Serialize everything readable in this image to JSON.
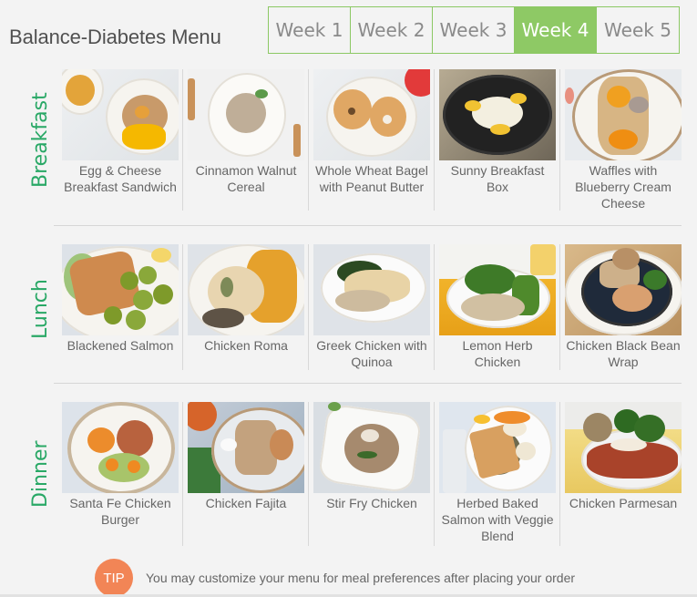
{
  "header": {
    "title": "Balance-Diabetes Menu"
  },
  "week_tabs": [
    {
      "label": "Week 1",
      "active": false
    },
    {
      "label": "Week 2",
      "active": false
    },
    {
      "label": "Week 3",
      "active": false
    },
    {
      "label": "Week 4",
      "active": true
    },
    {
      "label": "Week 5",
      "active": false
    }
  ],
  "colors": {
    "accent_green": "#8ec965",
    "section_label_green": "#29a866",
    "tip_orange": "#f28556"
  },
  "sections": [
    {
      "label": "Breakfast",
      "meals": [
        {
          "name": "Egg & Cheese Breakfast Sandwich",
          "lines": [
            "Egg & Cheese",
            "Breakfast Sandwich"
          ]
        },
        {
          "name": "Cinnamon Walnut Cereal",
          "lines": [
            "Cinnamon Walnut",
            "Cereal"
          ]
        },
        {
          "name": "Whole Wheat Bagel with Peanut Butter",
          "lines": [
            "Whole Wheat Bagel",
            "with Peanut Butter"
          ]
        },
        {
          "name": "Sunny Breakfast Box",
          "lines": [
            "Sunny Breakfast",
            "Box"
          ]
        },
        {
          "name": "Waffles with Blueberry Cream Cheese",
          "lines": [
            "Waffles with",
            "Blueberry Cream",
            "Cheese"
          ]
        }
      ]
    },
    {
      "label": "Lunch",
      "meals": [
        {
          "name": "Blackened Salmon",
          "lines": [
            "Blackened Salmon"
          ]
        },
        {
          "name": "Chicken Roma",
          "lines": [
            "Chicken Roma"
          ]
        },
        {
          "name": "Greek Chicken with Quinoa",
          "lines": [
            "Greek Chicken with",
            "Quinoa"
          ]
        },
        {
          "name": "Lemon Herb Chicken",
          "lines": [
            "Lemon Herb",
            "Chicken"
          ]
        },
        {
          "name": "Chicken Black Bean Wrap",
          "lines": [
            "Chicken Black Bean",
            "Wrap"
          ]
        }
      ]
    },
    {
      "label": "Dinner",
      "meals": [
        {
          "name": "Santa Fe Chicken Burger",
          "lines": [
            "Santa Fe Chicken",
            "Burger"
          ]
        },
        {
          "name": "Chicken Fajita",
          "lines": [
            "Chicken Fajita"
          ]
        },
        {
          "name": "Stir Fry Chicken",
          "lines": [
            "Stir Fry Chicken"
          ]
        },
        {
          "name": "Herbed Baked Salmon with Veggie Blend",
          "lines": [
            "Herbed Baked",
            "Salmon with Veggie",
            "Blend"
          ]
        },
        {
          "name": "Chicken Parmesan",
          "lines": [
            "Chicken Parmesan"
          ]
        }
      ]
    }
  ],
  "tip": {
    "badge": "TIP",
    "text": "You may customize your menu for meal preferences after placing your order"
  }
}
